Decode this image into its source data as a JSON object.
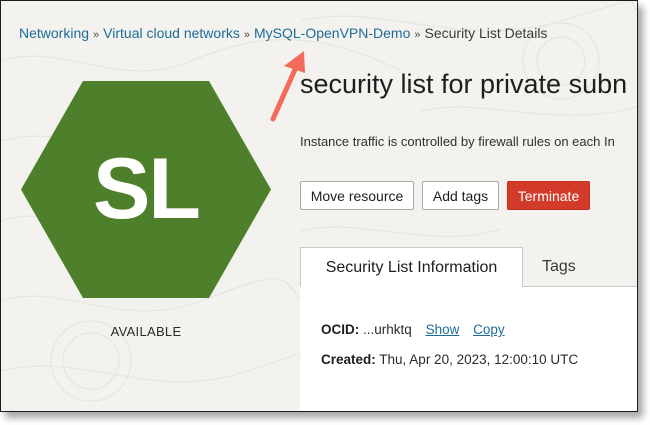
{
  "breadcrumb": {
    "items": [
      "Networking",
      "Virtual cloud networks",
      "MySQL-OpenVPN-Demo"
    ],
    "current": "Security List Details",
    "separator": "»"
  },
  "resource": {
    "icon_text": "SL",
    "icon_color": "#4e7f2b",
    "status": "AVAILABLE",
    "title": "security list for private subn",
    "description": "Instance traffic is controlled by firewall rules on each In"
  },
  "actions": {
    "move": "Move resource",
    "add_tags": "Add tags",
    "terminate": "Terminate"
  },
  "tabs": [
    {
      "label": "Security List Information",
      "active": true
    },
    {
      "label": "Tags",
      "active": false
    }
  ],
  "info": {
    "ocid_label": "OCID:",
    "ocid_value": "...urhktq",
    "show": "Show",
    "copy": "Copy",
    "created_label": "Created:",
    "created_value": "Thu, Apr 20, 2023, 12:00:10 UTC"
  },
  "colors": {
    "link": "#1c6c98",
    "danger": "#d23a2a",
    "annotation_arrow": "#f26b5b"
  }
}
